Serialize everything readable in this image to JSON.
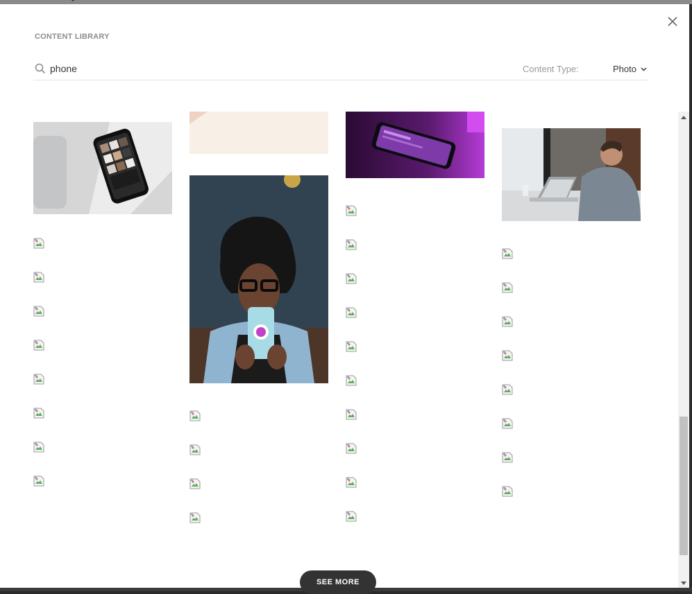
{
  "modal": {
    "title": "CONTENT LIBRARY",
    "close_icon": "close-icon"
  },
  "search": {
    "value": "phone",
    "icon": "search-icon"
  },
  "filter": {
    "label": "Content Type:",
    "value": "Photo",
    "icon": "chevron-down-icon"
  },
  "results": {
    "photos": [
      {
        "name": "phone-on-desk-photo",
        "colors": [
          "#d9d9d9",
          "#111111"
        ]
      },
      {
        "name": "beige-partial-photo",
        "colors": [
          "#f7efe6",
          "#f1d8c8"
        ]
      },
      {
        "name": "woman-selfie-photo",
        "colors": [
          "#2f3f4d",
          "#7fd3e0"
        ]
      },
      {
        "name": "purple-phone-photo",
        "colors": [
          "#3a1046",
          "#b02cd1"
        ]
      },
      {
        "name": "man-laptop-cafe-photo",
        "colors": [
          "#c9cdd1",
          "#5c6670"
        ]
      }
    ],
    "broken_image_icon": "broken-image-icon"
  },
  "actions": {
    "see_more": "SEE MORE"
  }
}
